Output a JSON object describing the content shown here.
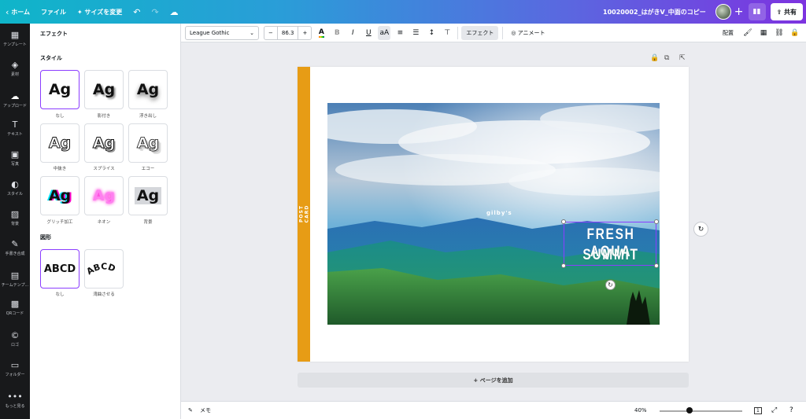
{
  "topbar": {
    "home": "ホーム",
    "file": "ファイル",
    "resize": "サイズを変更",
    "doc_title": "10020002_はがきV_中面のコピー",
    "share": "共有",
    "icons": [
      "chevron-left-icon",
      "undo-icon",
      "redo-icon",
      "cloud-icon",
      "chart-icon",
      "share-icon"
    ]
  },
  "rail": [
    {
      "label": "テンプレート",
      "icon": "▦"
    },
    {
      "label": "素材",
      "icon": "◈"
    },
    {
      "label": "アップロード",
      "icon": "☁"
    },
    {
      "label": "テキスト",
      "icon": "T"
    },
    {
      "label": "写真",
      "icon": "▣"
    },
    {
      "label": "スタイル",
      "icon": "◐"
    },
    {
      "label": "背景",
      "icon": "▨"
    },
    {
      "label": "手書き合成",
      "icon": "✎"
    },
    {
      "label": "チームテンプ...",
      "icon": "▤"
    },
    {
      "label": "QRコード",
      "icon": "▩"
    },
    {
      "label": "ロゴ",
      "icon": "©"
    },
    {
      "label": "フォルダー",
      "icon": "▭"
    },
    {
      "label": "もっと見る",
      "icon": "•••"
    }
  ],
  "panel": {
    "title": "エフェクト",
    "style_section": "スタイル",
    "shape_section": "図形",
    "styles": [
      {
        "label": "なし",
        "text": "Ag",
        "selected": true
      },
      {
        "label": "影付き",
        "text": "Ag",
        "selected": false
      },
      {
        "label": "浮き出し",
        "text": "Ag",
        "selected": false
      },
      {
        "label": "中抜き",
        "text": "Ag",
        "selected": false
      },
      {
        "label": "スプライス",
        "text": "Ag",
        "selected": false
      },
      {
        "label": "エコー",
        "text": "Ag",
        "selected": false
      },
      {
        "label": "グリッチ加工",
        "text": "Ag",
        "selected": false
      },
      {
        "label": "ネオン",
        "text": "Ag",
        "selected": false
      },
      {
        "label": "背景",
        "text": "Ag",
        "selected": false
      }
    ],
    "shapes": [
      {
        "label": "なし",
        "text": "ABCD",
        "selected": true
      },
      {
        "label": "湾曲させる",
        "text": "ABCD",
        "selected": false
      }
    ]
  },
  "toolbar": {
    "font": "League Gothic",
    "size": "86.3",
    "minus": "−",
    "plus": "+",
    "color_letter": "A",
    "bold": "B",
    "italic": "I",
    "underline": "U",
    "case": "aA",
    "effects": "エフェクト",
    "animate": "アニメート",
    "position": "配置"
  },
  "canvas": {
    "stripe_text": "POST CARD",
    "brand": "gilby's",
    "headline_line1": "FRESH AQUA",
    "headline_line2": "SUMMIT",
    "add_page": "+ ページを追加",
    "accent": "#e79c15",
    "selection_color": "#8b3dff"
  },
  "footer": {
    "notes": "メモ",
    "zoom": "40%",
    "page_count": "1",
    "zoom_fraction": 0.33
  }
}
